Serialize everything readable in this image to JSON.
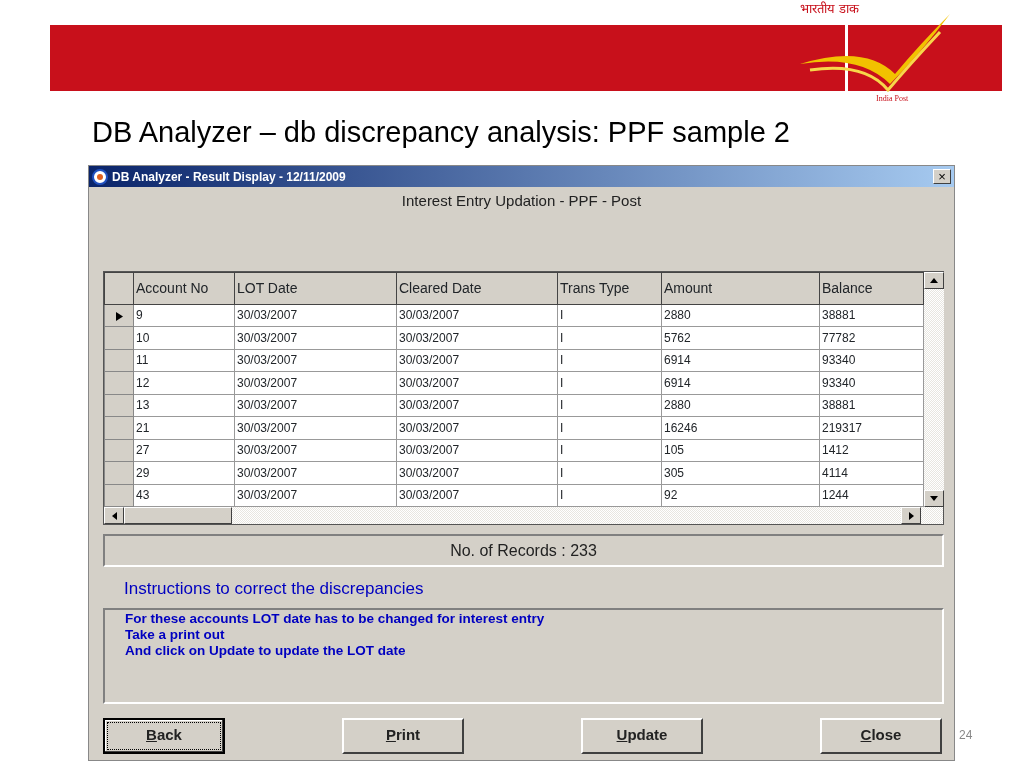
{
  "header": {
    "logo_script": "भारतीय डाक",
    "logo_caption": "India Post"
  },
  "slide_title": "DB Analyzer – db discrepancy analysis: PPF sample 2",
  "window": {
    "title": "DB Analyzer - Result Display - 12/11/2009",
    "close": "×",
    "heading": "Interest Entry Updation - PPF - Post"
  },
  "table": {
    "columns": [
      "Account No",
      "LOT Date",
      "Cleared Date",
      "Trans Type",
      "Amount",
      "Balance"
    ],
    "rows": [
      {
        "selected": true,
        "cells": [
          "9",
          "30/03/2007",
          "30/03/2007",
          "I",
          "2880",
          "38881"
        ]
      },
      {
        "selected": false,
        "cells": [
          "10",
          "30/03/2007",
          "30/03/2007",
          "I",
          "5762",
          "77782"
        ]
      },
      {
        "selected": false,
        "cells": [
          "11",
          "30/03/2007",
          "30/03/2007",
          "I",
          "6914",
          "93340"
        ]
      },
      {
        "selected": false,
        "cells": [
          "12",
          "30/03/2007",
          "30/03/2007",
          "I",
          "6914",
          "93340"
        ]
      },
      {
        "selected": false,
        "cells": [
          "13",
          "30/03/2007",
          "30/03/2007",
          "I",
          "2880",
          "38881"
        ]
      },
      {
        "selected": false,
        "cells": [
          "21",
          "30/03/2007",
          "30/03/2007",
          "I",
          "16246",
          "219317"
        ]
      },
      {
        "selected": false,
        "cells": [
          "27",
          "30/03/2007",
          "30/03/2007",
          "I",
          "105",
          "1412"
        ]
      },
      {
        "selected": false,
        "cells": [
          "29",
          "30/03/2007",
          "30/03/2007",
          "I",
          "305",
          "4114"
        ]
      },
      {
        "selected": false,
        "cells": [
          "43",
          "30/03/2007",
          "30/03/2007",
          "I",
          "92",
          "1244"
        ]
      }
    ]
  },
  "records": "No. of Records : 233",
  "instructions_label": "Instructions to correct the discrepancies",
  "instructions": [
    "For these accounts LOT date has to be changed for interest entry",
    "Take a print out",
    "And click on Update to update the LOT date"
  ],
  "buttons": [
    {
      "label": "Back",
      "focused": true
    },
    {
      "label": "Print",
      "focused": false
    },
    {
      "label": "Update",
      "focused": false
    },
    {
      "label": "Close",
      "focused": false
    }
  ],
  "page_number": "24"
}
